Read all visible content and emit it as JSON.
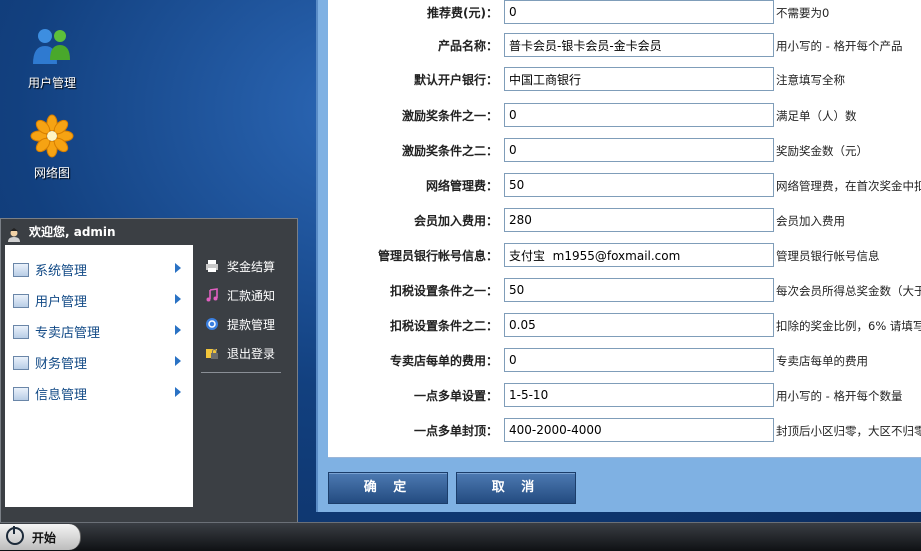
{
  "desktop": {
    "icons": [
      {
        "label": "用户管理",
        "icon": "users-icon"
      },
      {
        "label": "网络图",
        "icon": "network-flower-icon"
      }
    ]
  },
  "form": {
    "rows": [
      {
        "label": "推荐费(元)：",
        "value": "0",
        "hint": "不需要为0"
      },
      {
        "label": "产品名称：",
        "value": "普卡会员-银卡会员-金卡会员",
        "hint": "用小写的 - 格开每个产品"
      },
      {
        "label": "默认开户银行：",
        "value": "中国工商银行",
        "hint": "注意填写全称"
      },
      {
        "label": "激励奖条件之一：",
        "value": "0",
        "hint": "满足单（人）数"
      },
      {
        "label": "激励奖条件之二：",
        "value": "0",
        "hint": "奖励奖金数（元）"
      },
      {
        "label": "网络管理费：",
        "value": "50",
        "hint": "网络管理费，在首次奖金中扣"
      },
      {
        "label": "会员加入费用：",
        "value": "280",
        "hint": "会员加入费用"
      },
      {
        "label": "管理员银行帐号信息：",
        "value": "支付宝  m1955@foxmail.com",
        "hint": "管理员银行帐号信息"
      },
      {
        "label": "扣税设置条件之一：",
        "value": "50",
        "hint": "每次会员所得总奖金数（大于"
      },
      {
        "label": "扣税设置条件之二：",
        "value": "0.05",
        "hint": "扣除的奖金比例，6% 请填写"
      },
      {
        "label": "专卖店每单的费用：",
        "value": "0",
        "hint": "专卖店每单的费用"
      },
      {
        "label": "一点多单设置：",
        "value": "1-5-10",
        "hint": "用小写的 - 格开每个数量"
      },
      {
        "label": "一点多单封顶：",
        "value": "400-2000-4000",
        "hint": "封顶后小区归零，大区不归零"
      }
    ],
    "confirm_label": "确 定",
    "cancel_label": "取 消"
  },
  "start_menu": {
    "welcome": "欢迎您, admin",
    "left_items": [
      "系统管理",
      "用户管理",
      "专卖店管理",
      "财务管理",
      "信息管理"
    ],
    "right_items": [
      {
        "label": "奖金结算",
        "icon": "printer-icon"
      },
      {
        "label": "汇款通知",
        "icon": "music-note-icon"
      },
      {
        "label": "提款管理",
        "icon": "refresh-icon"
      },
      {
        "label": "退出登录",
        "icon": "folder-lock-icon"
      }
    ]
  },
  "taskbar": {
    "start_label": "开始"
  }
}
